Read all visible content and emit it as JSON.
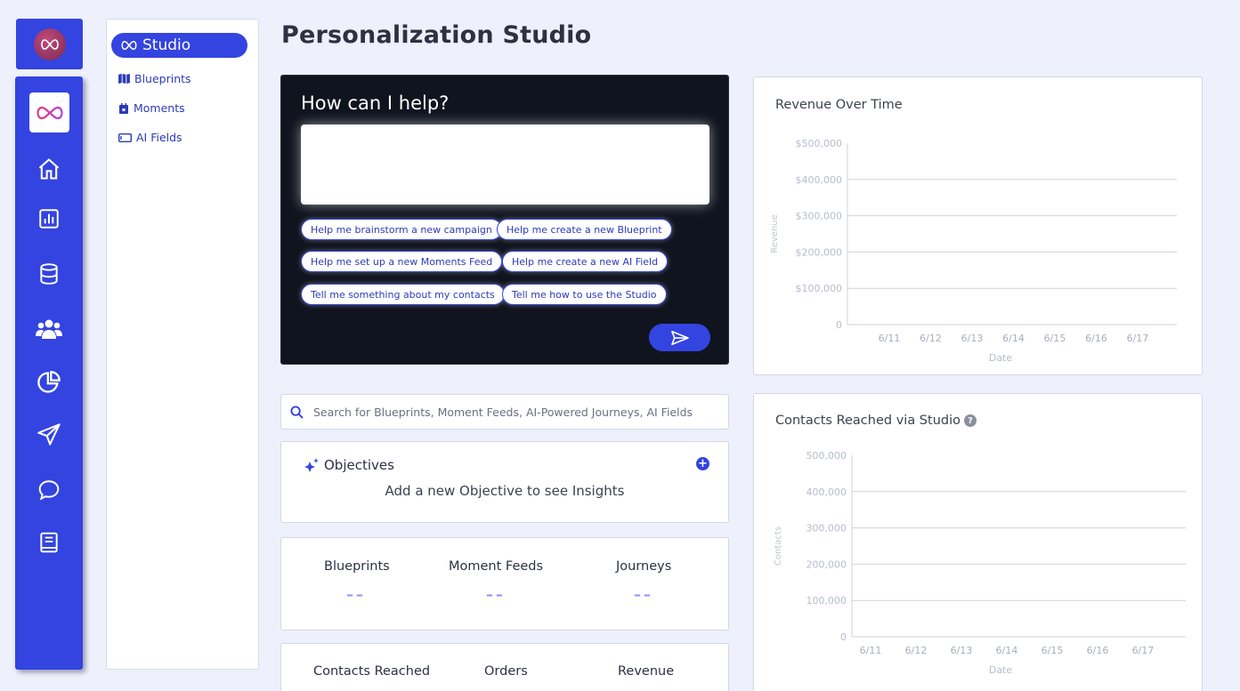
{
  "nav": {
    "studio_label": "Studio",
    "items": [
      {
        "label": "Blueprints"
      },
      {
        "label": "Moments"
      },
      {
        "label": "AI Fields"
      }
    ]
  },
  "page": {
    "title": "Personalization Studio"
  },
  "chat": {
    "title": "How can I help?",
    "input_value": "",
    "suggestions": [
      "Help me brainstorm a new campaign",
      "Help me create a new Blueprint",
      "Help me set up a new Moments Feed",
      "Help me create a new AI Field",
      "Tell me something about my contacts",
      "Tell me how to use the Studio"
    ]
  },
  "search": {
    "placeholder": "Search for Blueprints, Moment Feeds, AI-Powered Journeys, AI Fields"
  },
  "objectives": {
    "title": "Objectives",
    "empty_message": "Add a new Objective to see Insights",
    "add_symbol": "+"
  },
  "stats_top": [
    {
      "label": "Blueprints",
      "value": "––"
    },
    {
      "label": "Moment Feeds",
      "value": "––"
    },
    {
      "label": "Journeys",
      "value": "––"
    }
  ],
  "stats_bottom": [
    {
      "label": "Contacts Reached"
    },
    {
      "label": "Orders"
    },
    {
      "label": "Revenue"
    }
  ],
  "chart_data": [
    {
      "type": "line",
      "title": "Revenue Over Time",
      "xlabel": "Date",
      "ylabel": "Revenue",
      "categories": [
        "6/11",
        "6/12",
        "6/13",
        "6/14",
        "6/15",
        "6/16",
        "6/17"
      ],
      "y_ticks": [
        "0",
        "$100,000",
        "$200,000",
        "$300,000",
        "$400,000",
        "$500,000"
      ],
      "ylim": [
        0,
        500000
      ],
      "series": [],
      "grid": true
    },
    {
      "type": "line",
      "title": "Contacts Reached via Studio",
      "help_symbol": "?",
      "xlabel": "Date",
      "ylabel": "Contacts",
      "categories": [
        "6/11",
        "6/12",
        "6/13",
        "6/14",
        "6/15",
        "6/16",
        "6/17"
      ],
      "y_ticks": [
        "0",
        "100,000",
        "200,000",
        "300,000",
        "400,000",
        "500,000"
      ],
      "ylim": [
        0,
        500000
      ],
      "series": [],
      "grid": true
    }
  ],
  "colors": {
    "accent": "#3344e0",
    "dark_panel": "#10141f",
    "background": "#eef0fb"
  },
  "icons": [
    "logo-icon",
    "home-icon",
    "analytics-icon",
    "database-icon",
    "users-icon",
    "pie-chart-icon",
    "send-icon",
    "chat-icon",
    "book-icon",
    "map-icon",
    "calendar-icon",
    "ai-field-icon",
    "search-icon",
    "sparkle-icon",
    "plus-icon",
    "help-icon"
  ]
}
